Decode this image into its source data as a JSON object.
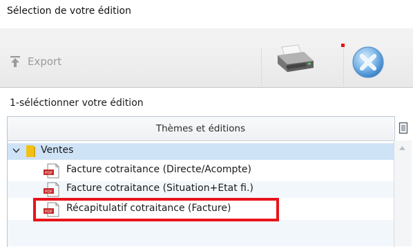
{
  "window": {
    "title": "Sélection de votre édition"
  },
  "toolbar": {
    "export_label": "Export"
  },
  "step": {
    "label": "1-séléctionner votre édition"
  },
  "grid": {
    "header": "Thèmes et éditions",
    "group": {
      "label": "Ventes",
      "expanded": true,
      "icon": "folder-icon"
    },
    "items": [
      {
        "label": "Facture cotraitance (Directe/Acompte)",
        "icon": "pdf-icon"
      },
      {
        "label": "Facture cotraitance (Situation+Etat fi.)",
        "icon": "pdf-icon"
      },
      {
        "label": "Récapitulatif cotraitance (Facture)",
        "icon": "pdf-icon",
        "highlighted": true
      }
    ]
  },
  "colors": {
    "selection": "#cfe3f7",
    "highlight": "#e8131b",
    "folder": "#f2c012",
    "pdf": "#c62828"
  }
}
